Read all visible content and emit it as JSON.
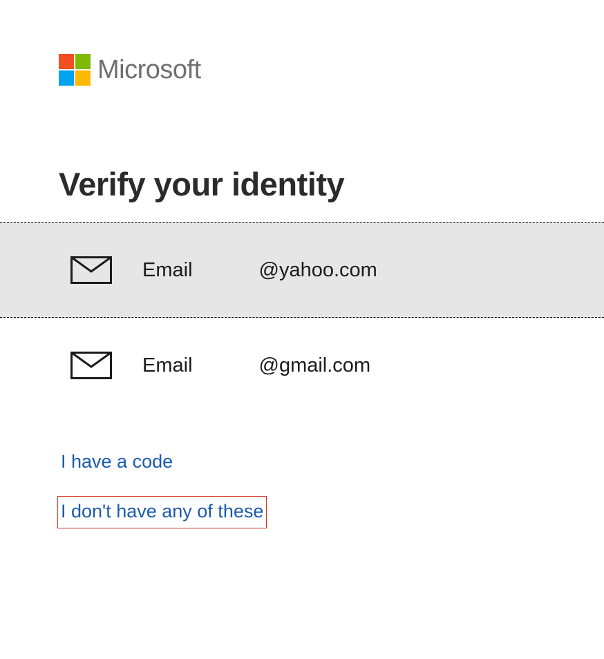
{
  "header": {
    "brand": "Microsoft"
  },
  "title": "Verify your identity",
  "options": [
    {
      "label": "Email",
      "value": "@yahoo.com"
    },
    {
      "label": "Email",
      "value": "@gmail.com"
    }
  ],
  "links": {
    "have_code": "I have a code",
    "none_of_these": "I don't have any of these"
  }
}
